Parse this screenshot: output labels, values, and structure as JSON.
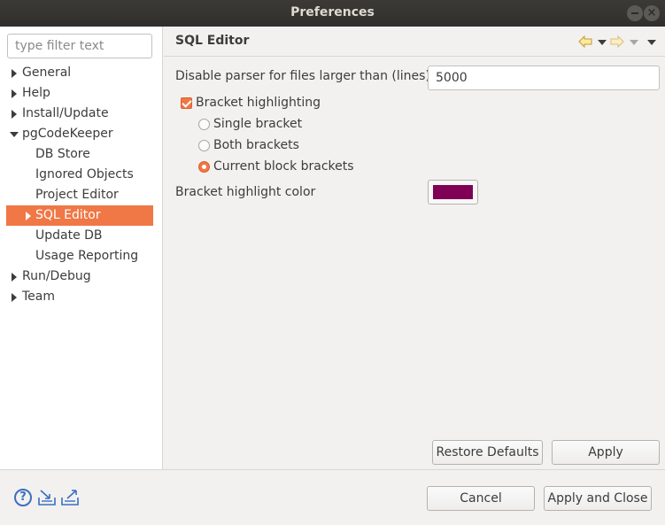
{
  "window": {
    "title": "Preferences"
  },
  "filter": {
    "placeholder": "type filter text"
  },
  "tree": [
    {
      "label": "General",
      "arrow": "right",
      "level": 0
    },
    {
      "label": "Help",
      "arrow": "right",
      "level": 0
    },
    {
      "label": "Install/Update",
      "arrow": "right",
      "level": 0
    },
    {
      "label": "pgCodeKeeper",
      "arrow": "down",
      "level": 0
    },
    {
      "label": "DB Store",
      "arrow": "none",
      "level": 1
    },
    {
      "label": "Ignored Objects",
      "arrow": "none",
      "level": 1
    },
    {
      "label": "Project Editor",
      "arrow": "none",
      "level": 1
    },
    {
      "label": "SQL Editor",
      "arrow": "right",
      "level": 1,
      "selected": true
    },
    {
      "label": "Update DB",
      "arrow": "none",
      "level": 1
    },
    {
      "label": "Usage Reporting",
      "arrow": "none",
      "level": 1
    },
    {
      "label": "Run/Debug",
      "arrow": "right",
      "level": 0
    },
    {
      "label": "Team",
      "arrow": "right",
      "level": 0
    }
  ],
  "page": {
    "title": "SQL Editor",
    "parser_label": "Disable parser for files larger than (lines):",
    "parser_value": "5000",
    "bracket_highlighting_label": "Bracket highlighting",
    "bracket_highlighting_checked": true,
    "radios": [
      {
        "label": "Single bracket",
        "checked": false
      },
      {
        "label": "Both brackets",
        "checked": false
      },
      {
        "label": "Current block brackets",
        "checked": true
      }
    ],
    "color_label": "Bracket highlight color",
    "highlight_color": "#7f0055"
  },
  "buttons": {
    "restore_defaults": "Restore Defaults",
    "apply": "Apply",
    "cancel": "Cancel",
    "apply_and_close": "Apply and Close"
  },
  "accent_color": "#f07746"
}
